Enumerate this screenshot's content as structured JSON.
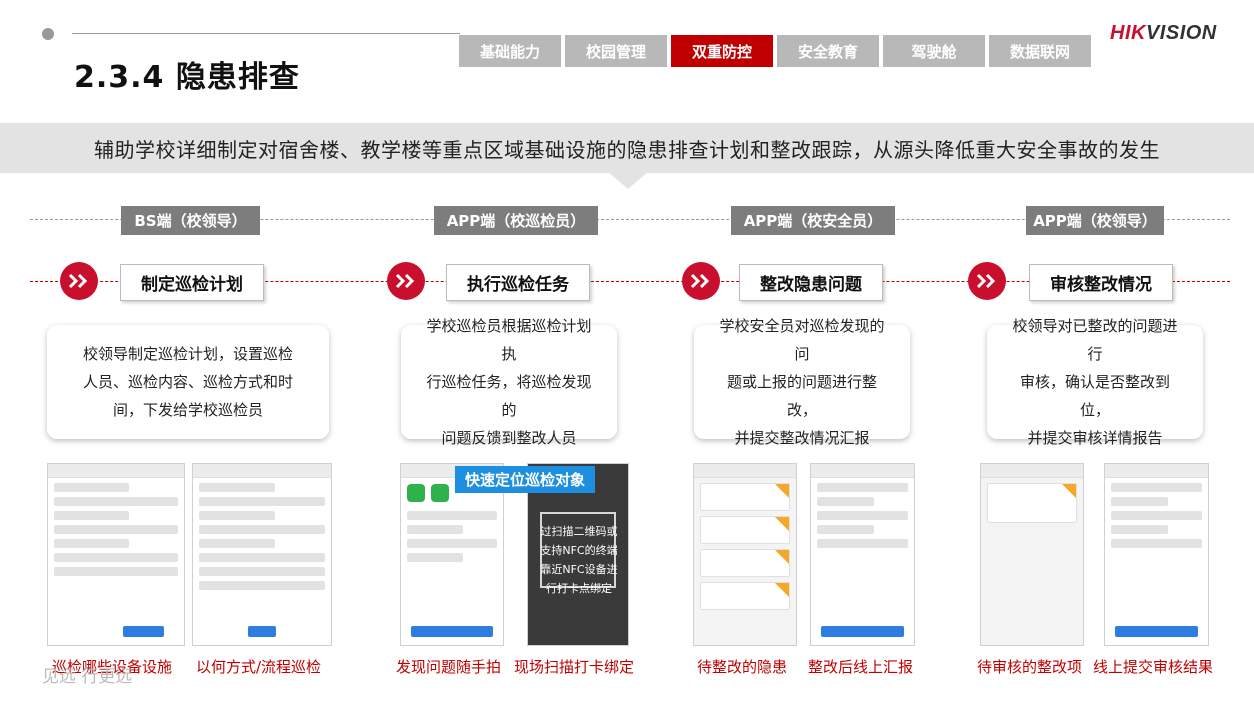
{
  "header": {
    "title": "2.3.4 隐患排查",
    "tabs": [
      {
        "label": "基础能力",
        "active": false
      },
      {
        "label": "校园管理",
        "active": false
      },
      {
        "label": "双重防控",
        "active": true
      },
      {
        "label": "安全教育",
        "active": false
      },
      {
        "label": "驾驶舱",
        "active": false
      },
      {
        "label": "数据联网",
        "active": false
      }
    ],
    "logo": {
      "part1": "HIK",
      "part2": "VISION"
    }
  },
  "banner": "辅助学校详细制定对宿舍楼、教学楼等重点区域基础设施的隐患排查计划和整改跟踪，从源头降低重大安全事故的发生",
  "columns": [
    {
      "role": "BS端（校领导）",
      "step": "制定巡检计划",
      "description": [
        "校领导制定巡检计划，设置巡检",
        "人员、巡检内容、巡检方式和时",
        "间，下发给学校巡检员"
      ],
      "captions": [
        "巡检哪些设备设施",
        "以何方式/流程巡检"
      ]
    },
    {
      "role": "APP端（校巡检员）",
      "step": "执行巡检任务",
      "description": [
        "学校巡检员根据巡检计划执",
        "行巡检任务，将巡检发现的",
        "问题反馈到整改人员"
      ],
      "captions": [
        "发现问题随手拍",
        "现场扫描打卡绑定"
      ],
      "badge": "快速定位巡检对象",
      "scan_text": [
        "过扫描二维码或",
        "支持NFC的终端",
        "靠近NFC设备进",
        "行打卡点绑定"
      ]
    },
    {
      "role": "APP端（校安全员）",
      "step": "整改隐患问题",
      "description": [
        "学校安全员对巡检发现的问",
        "题或上报的问题进行整改，",
        "并提交整改情况汇报"
      ],
      "captions": [
        "待整改的隐患",
        "整改后线上汇报"
      ]
    },
    {
      "role": "APP端（校领导）",
      "step": "审核整改情况",
      "description": [
        "校领导对已整改的问题进行",
        "审核，确认是否整改到位，",
        "并提交审核详情报告"
      ],
      "captions": [
        "待审核的整改项",
        "线上提交审核结果"
      ]
    }
  ],
  "footer": "见远 行更远"
}
